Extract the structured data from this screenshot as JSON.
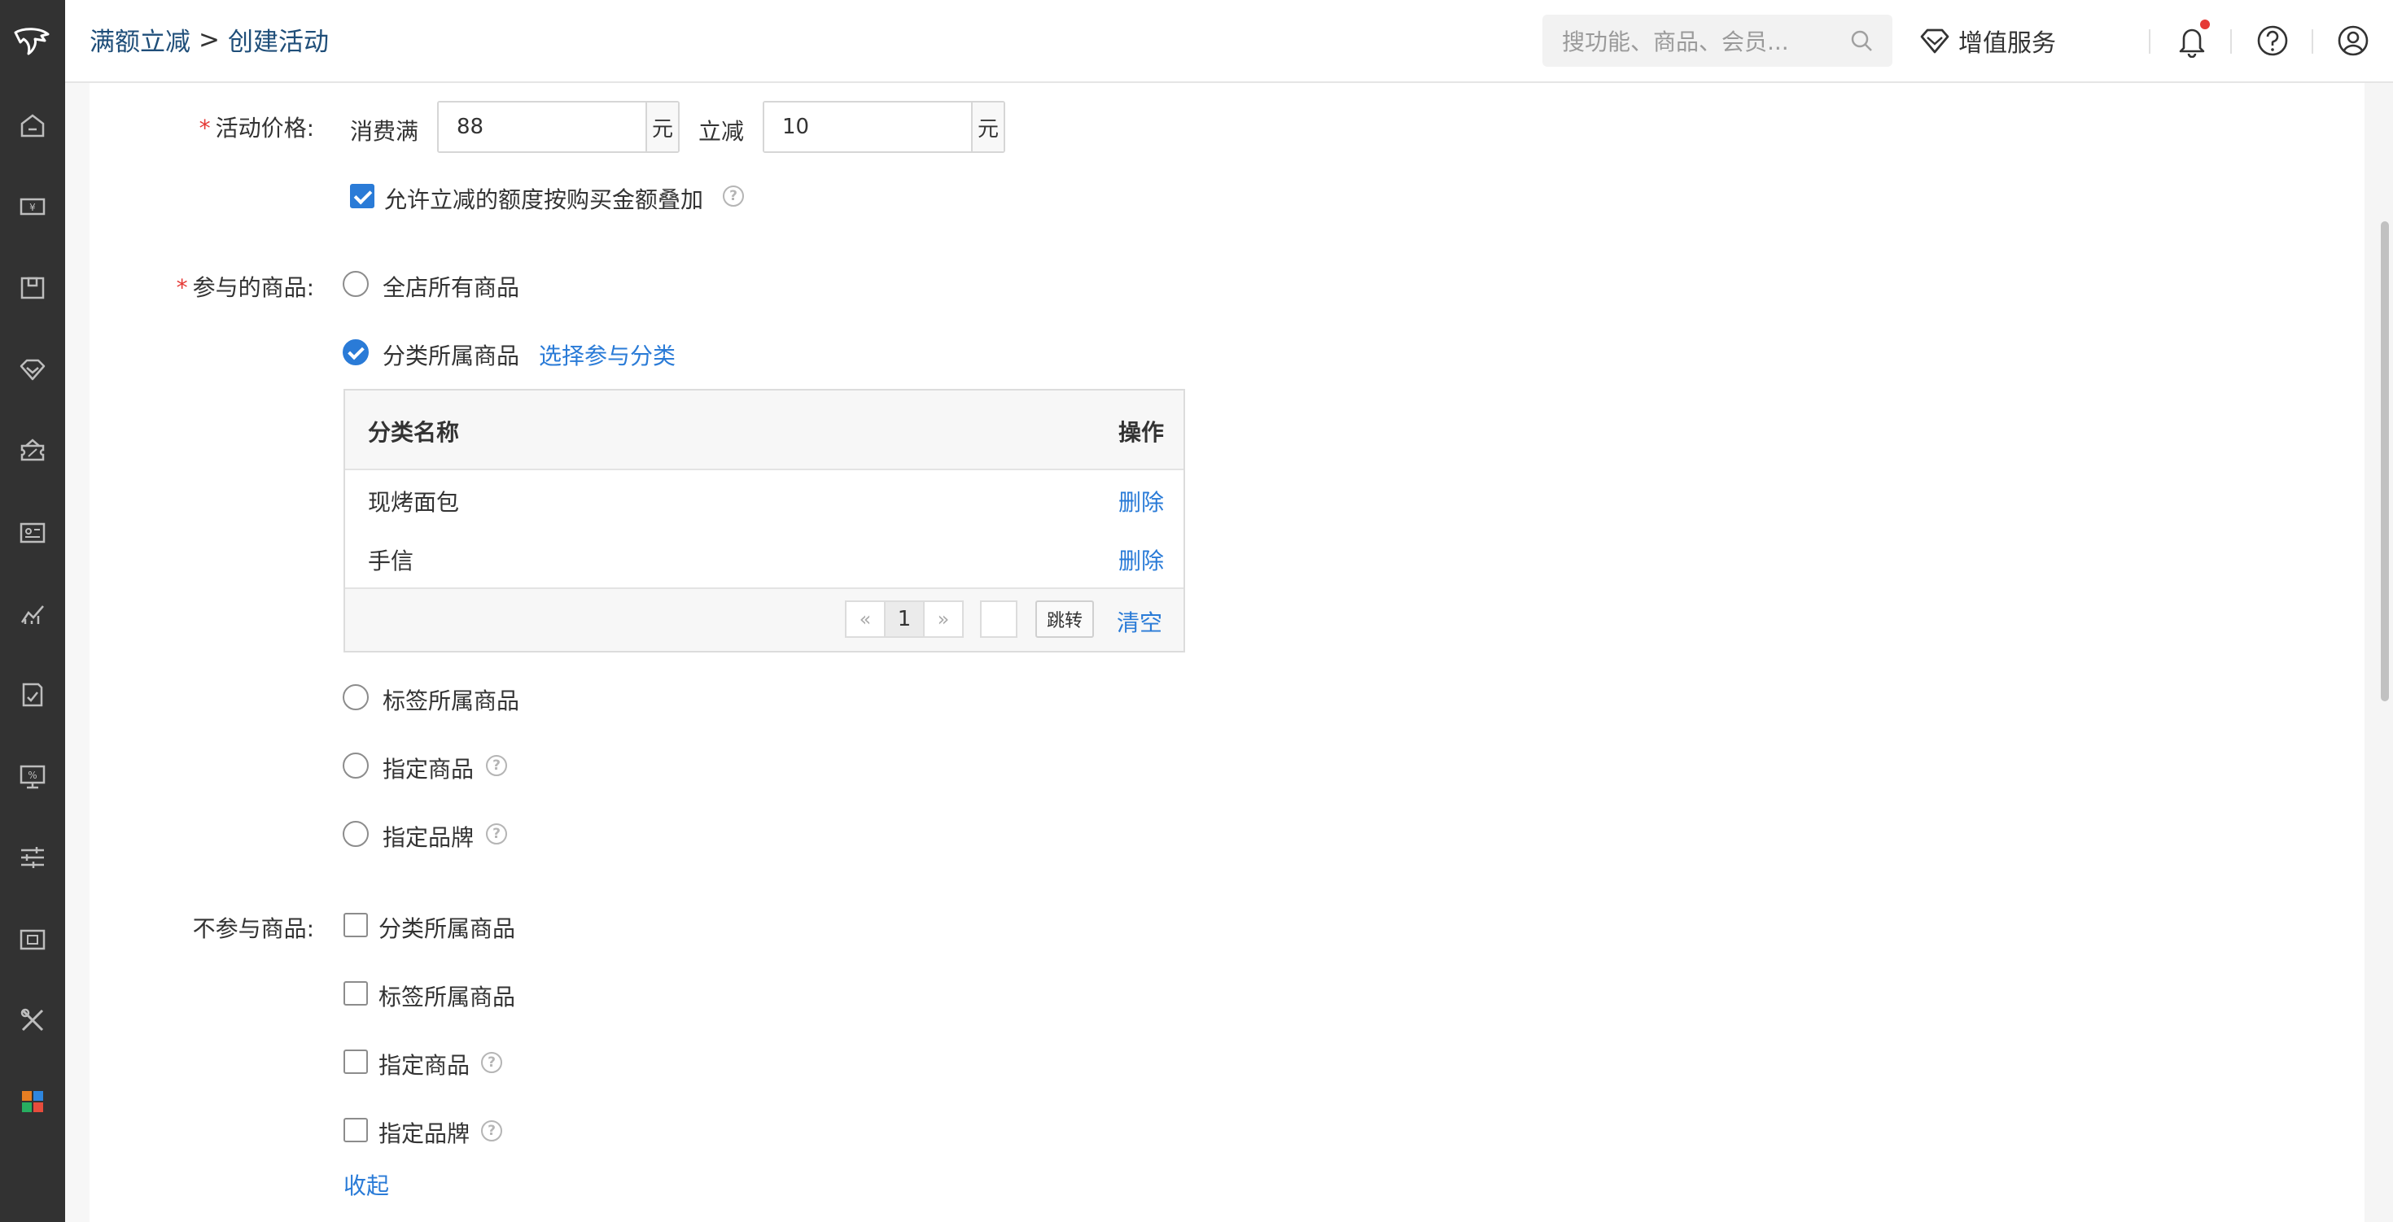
{
  "breadcrumb": {
    "parent": "满额立减",
    "separator": ">",
    "current": "创建活动"
  },
  "topbar": {
    "search_placeholder": "搜功能、商品、会员...",
    "value_service_label": "增值服务"
  },
  "sidebar": {
    "icons": [
      "home-icon",
      "cashier-icon",
      "package-icon",
      "diamond-icon",
      "coupon-icon",
      "member-card-icon",
      "chart-icon",
      "report-icon",
      "promotion-icon",
      "settings-sliders-icon",
      "card-icon",
      "tools-icon",
      "apps-icon"
    ]
  },
  "form": {
    "price": {
      "label": "活动价格:",
      "spend_label": "消费满",
      "spend_value": "88",
      "unit": "元",
      "reduce_label": "立减",
      "reduce_value": "10",
      "stack_checkbox_label": "允许立减的额度按购买金额叠加",
      "stack_checked": true
    },
    "participate": {
      "label": "参与的商品:",
      "options": {
        "all": "全店所有商品",
        "category": "分类所属商品",
        "tag": "标签所属商品",
        "product": "指定商品",
        "brand": "指定品牌"
      },
      "selected": "category",
      "choose_link": "选择参与分类",
      "table": {
        "col_name": "分类名称",
        "col_action": "操作",
        "rows": [
          {
            "name": "现烤面包",
            "action": "删除"
          },
          {
            "name": "手信",
            "action": "删除"
          }
        ],
        "pager": {
          "prev": "«",
          "page": "1",
          "next": "»"
        },
        "jump_label": "跳转",
        "clear_label": "清空"
      }
    },
    "exclude": {
      "label": "不参与商品:",
      "options": {
        "category": "分类所属商品",
        "tag": "标签所属商品",
        "product": "指定商品",
        "brand": "指定品牌"
      },
      "collapse_link": "收起"
    }
  }
}
